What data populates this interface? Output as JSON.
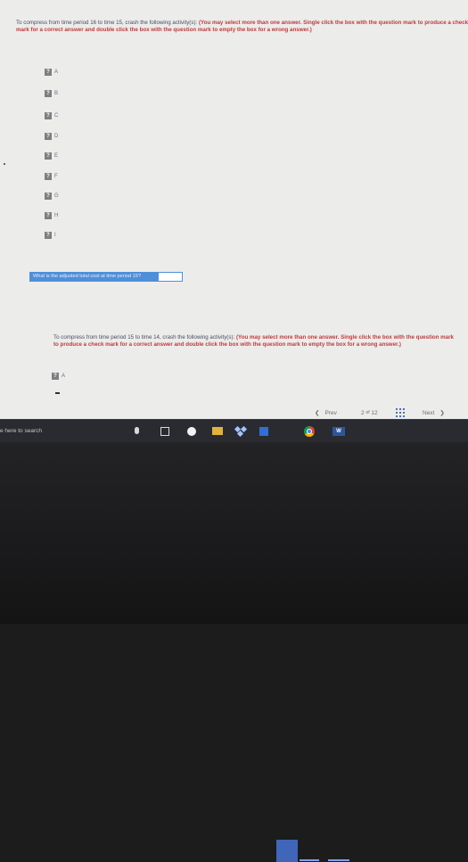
{
  "question1": {
    "text": "To compress from time period 16 to time 15, crash the following activity(s):",
    "instruction": "(You may select more than one answer. Single click the box with the question mark to produce a check mark for a correct answer and double click the box with the question mark to empty the box for a wrong answer.)",
    "options": [
      {
        "box": "?",
        "label": "A"
      },
      {
        "box": "?",
        "label": "B"
      },
      {
        "box": "?",
        "label": "C"
      },
      {
        "box": "?",
        "label": "D"
      },
      {
        "box": "?",
        "label": "E"
      },
      {
        "box": "?",
        "label": "F"
      },
      {
        "box": "?",
        "label": "G"
      },
      {
        "box": "?",
        "label": "H"
      },
      {
        "box": "?",
        "label": "I"
      }
    ]
  },
  "adjusted_cost": {
    "label": "What is the adjusted total cost at time period 15?",
    "value": ""
  },
  "question2": {
    "text": "To compress from time period 15 to time 14, crash the following activity(s):",
    "instruction": "(You may select more than one answer. Single click the box with the question mark to produce a check mark for a correct answer and double click the box with the question mark to empty the box for a wrong answer.)",
    "options": [
      {
        "box": "?",
        "label": "A"
      }
    ]
  },
  "pager": {
    "prev": "Prev",
    "page": "2",
    "of": "of",
    "total": "12",
    "next": "Next"
  },
  "taskbar": {
    "search": "e here to search",
    "word_label": "W"
  },
  "colors": {
    "instruction": "#c03a3a",
    "accent": "#4f8fd9",
    "taskbar": "#2a2b30"
  }
}
